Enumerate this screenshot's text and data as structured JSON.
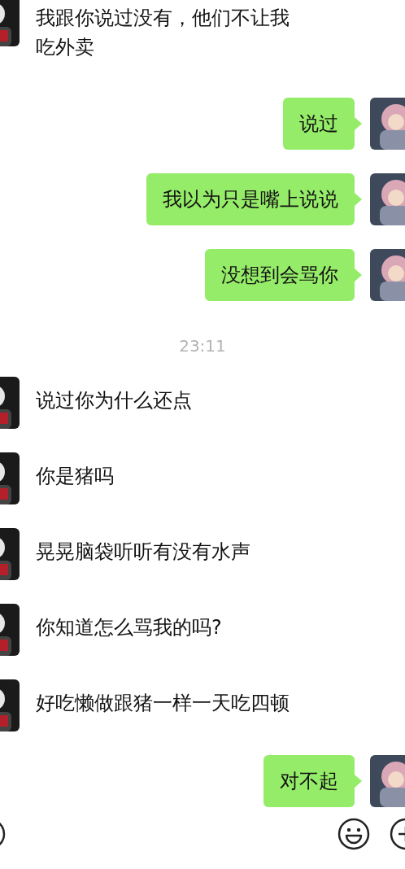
{
  "messages": [
    {
      "kind": "received",
      "text": "我跟你说过没有，他们不让我吃外卖"
    },
    {
      "kind": "sent",
      "text": "说过"
    },
    {
      "kind": "sent",
      "text": "我以为只是嘴上说说"
    },
    {
      "kind": "sent",
      "text": "没想到会骂你"
    },
    {
      "kind": "time",
      "text": "23:11"
    },
    {
      "kind": "received",
      "text": "说过你为什么还点"
    },
    {
      "kind": "received",
      "text": "你是猪吗"
    },
    {
      "kind": "received",
      "text": "晃晃脑袋听听有没有水声"
    },
    {
      "kind": "received",
      "text": "你知道怎么骂我的吗?"
    },
    {
      "kind": "received",
      "text": "好吃懒做跟猪一样一天吃四顿"
    },
    {
      "kind": "sent",
      "text": "对不起"
    }
  ]
}
